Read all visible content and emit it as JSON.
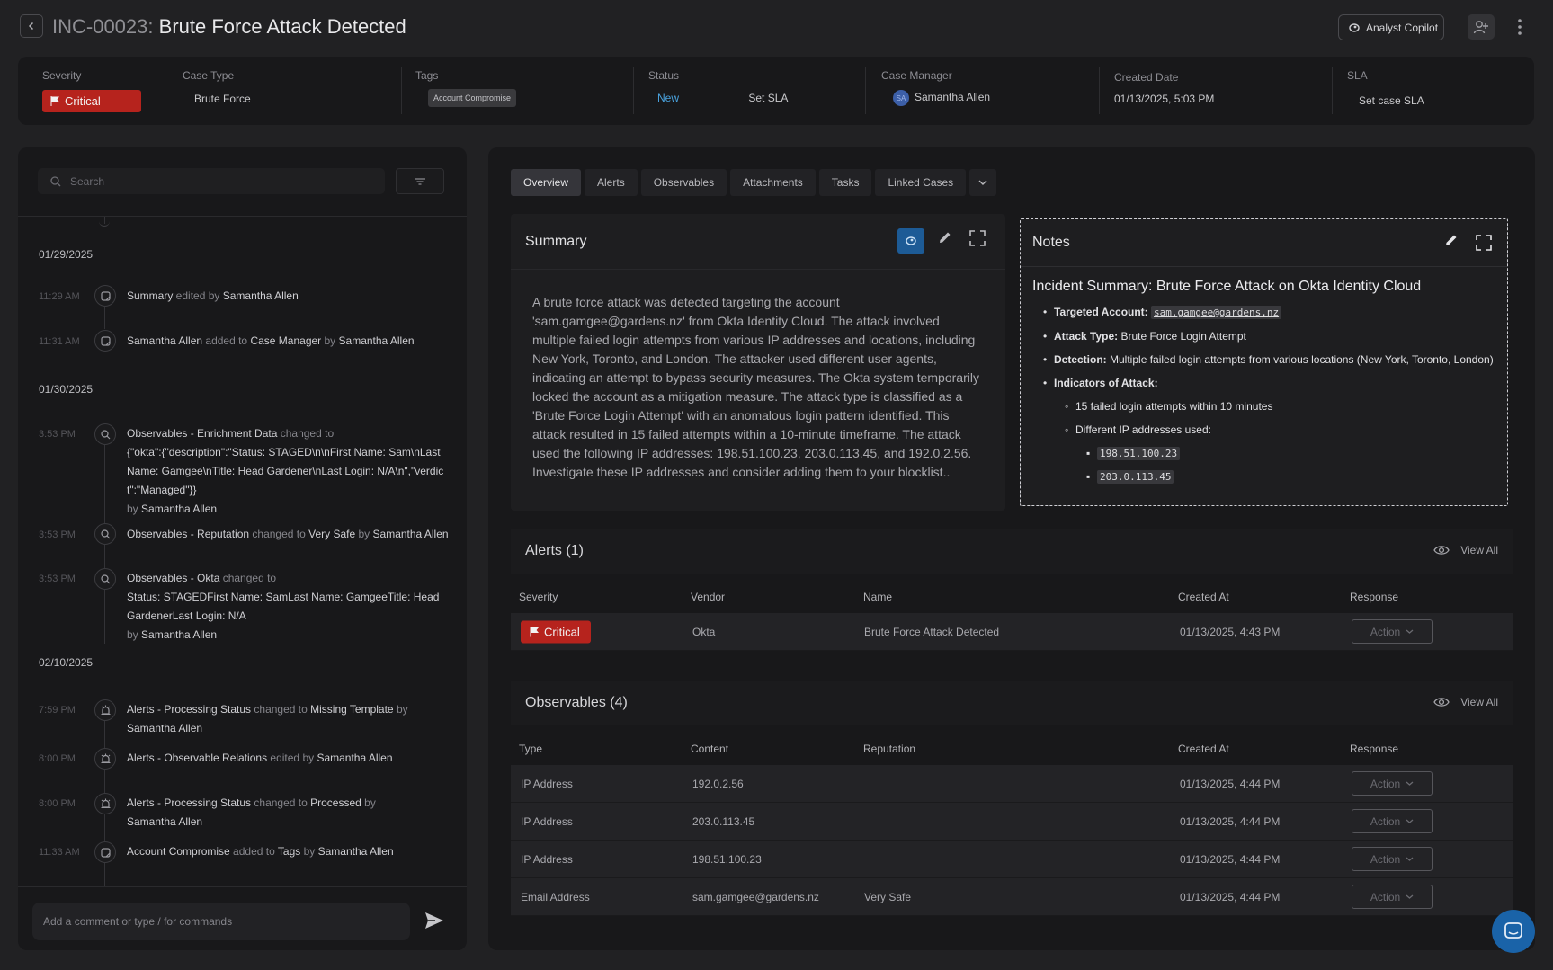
{
  "header": {
    "incident_id": "INC-00023:",
    "incident_title": "Brute Force Attack Detected",
    "copilot_label": "Analyst Copilot"
  },
  "info": {
    "severity_label": "Severity",
    "severity_value": "Critical",
    "case_type_label": "Case Type",
    "case_type_value": "Brute Force",
    "tags_label": "Tags",
    "tag_value": "Account Compromise",
    "status_label": "Status",
    "status_value": "New",
    "set_sla_label": "Set SLA",
    "case_manager_label": "Case Manager",
    "case_manager_initials": "SA",
    "case_manager_name": "Samantha Allen",
    "created_date_label": "Created Date",
    "created_date_value": "01/13/2025, 5:03 PM",
    "sla_label": "SLA",
    "sla_value": "Set case SLA"
  },
  "timeline": {
    "search_placeholder": "Search",
    "dates": [
      "01/29/2025",
      "01/30/2025",
      "02/10/2025"
    ],
    "events": [
      {
        "time": "11:29 AM",
        "p1": "Summary",
        "p2": " edited by ",
        "p3": "Samantha Allen",
        "p4": "",
        "p5": "",
        "p6": "",
        "p7": ""
      },
      {
        "time": "11:31 AM",
        "p1": "Samantha Allen",
        "p2": " added to ",
        "p3": "Case Manager",
        "p4": " by ",
        "p5": "Samantha Allen",
        "p6": "",
        "p7": ""
      },
      {
        "time": "3:53 PM",
        "p1": "Observables - Enrichment Data",
        "p2": " changed to ",
        "p3": "{\"okta\":{\"description\":\"Status: STAGED\\n\\nFirst Name: Sam\\nLast Name: Gamgee\\nTitle: Head Gardener\\nLast Login: N/A\\n\",\"verdict\":\"Managed\"}}",
        "p4": "by ",
        "p5": "Samantha Allen",
        "p6": "",
        "p7": ""
      },
      {
        "time": "3:53 PM",
        "p1": "Observables - Reputation",
        "p2": " changed to ",
        "p3": "Very Safe",
        "p4": " by ",
        "p5": "Samantha Allen",
        "p6": "",
        "p7": ""
      },
      {
        "time": "3:53 PM",
        "p1": "Observables - Okta",
        "p2": " changed to ",
        "p3": "Status: STAGEDFirst Name: SamLast Name: GamgeeTitle: Head GardenerLast Login: N/A",
        "p4": "by ",
        "p5": "Samantha Allen",
        "p6": "",
        "p7": ""
      },
      {
        "time": "7:59 PM",
        "p1": "Alerts - Processing Status",
        "p2": " changed to ",
        "p3": "Missing Template",
        "p4": " by ",
        "p5": "Samantha Allen",
        "p6": "",
        "p7": ""
      },
      {
        "time": "8:00 PM",
        "p1": "Alerts - Observable Relations",
        "p2": " edited by ",
        "p3": "Samantha Allen",
        "p4": "",
        "p5": "",
        "p6": "",
        "p7": ""
      },
      {
        "time": "8:00 PM",
        "p1": "Alerts - Processing Status",
        "p2": " changed to ",
        "p3": "Processed",
        "p4": " by ",
        "p5": "Samantha Allen",
        "p6": "",
        "p7": ""
      },
      {
        "time": "11:33 AM",
        "p1": "Account Compromise",
        "p2": " added to ",
        "p3": "Tags",
        "p4": " by ",
        "p5": "Samantha Allen",
        "p6": "",
        "p7": ""
      }
    ],
    "comment_placeholder": "Add a comment or type / for commands"
  },
  "tabs": [
    "Overview",
    "Alerts",
    "Observables",
    "Attachments",
    "Tasks",
    "Linked Cases"
  ],
  "summary": {
    "title": "Summary",
    "text": "A brute force attack was detected targeting the account 'sam.gamgee@gardens.nz' from Okta Identity Cloud. The attack involved multiple failed login attempts from various IP addresses and locations, including New York, Toronto, and London. The attacker used different user agents, indicating an attempt to bypass security measures.  The Okta system temporarily locked the account as a mitigation measure. The attack type is classified as a 'Brute Force Login Attempt' with an anomalous login pattern identified. This attack resulted in 15 failed attempts within a 10-minute timeframe.  The attack used the following IP addresses: 198.51.100.23, 203.0.113.45, and 192.0.2.56.  Investigate these IP addresses and consider adding them to your blocklist.."
  },
  "notes": {
    "title": "Notes",
    "heading": "Incident Summary: Brute Force Attack on Okta Identity Cloud",
    "targeted_label": "Targeted Account:",
    "targeted_value": "sam.gamgee@gardens.nz",
    "attack_type_label": "Attack Type:",
    "attack_type_value": "Brute Force Login Attempt",
    "detection_label": "Detection:",
    "detection_value": "Multiple failed login attempts from various locations (New York, Toronto, London)",
    "indicators_label": "Indicators of Attack:",
    "indicator_1": "15 failed login attempts within 10 minutes",
    "indicator_2": "Different IP addresses used:",
    "ip_1": "198.51.100.23",
    "ip_2": "203.0.113.45"
  },
  "alerts": {
    "title": "Alerts (1)",
    "view_all": "View All",
    "columns": [
      "Severity",
      "Vendor",
      "Name",
      "Created At",
      "Response"
    ],
    "rows": [
      {
        "severity": "Critical",
        "vendor": "Okta",
        "name": "Brute Force Attack Detected",
        "created_at": "01/13/2025, 4:43 PM",
        "action": "Action"
      }
    ]
  },
  "observables": {
    "title": "Observables (4)",
    "view_all": "View All",
    "columns": [
      "Type",
      "Content",
      "Reputation",
      "Created At",
      "Response"
    ],
    "rows": [
      {
        "type": "IP Address",
        "content": "192.0.2.56",
        "reputation": "",
        "created_at": "01/13/2025, 4:44 PM",
        "action": "Action"
      },
      {
        "type": "IP Address",
        "content": "203.0.113.45",
        "reputation": "",
        "created_at": "01/13/2025, 4:44 PM",
        "action": "Action"
      },
      {
        "type": "IP Address",
        "content": "198.51.100.23",
        "reputation": "",
        "created_at": "01/13/2025, 4:44 PM",
        "action": "Action"
      },
      {
        "type": "Email Address",
        "content": "sam.gamgee@gardens.nz",
        "reputation": "Very Safe",
        "created_at": "01/13/2025, 4:44 PM",
        "action": "Action"
      }
    ]
  },
  "colors": {
    "critical": "#b6231d",
    "accent": "#1d5b96",
    "status_new": "#4aa3df"
  }
}
